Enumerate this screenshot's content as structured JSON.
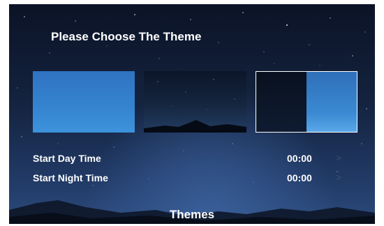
{
  "title": "Please Choose The Theme",
  "themes": [
    {
      "name": "blue-theme",
      "selected": false
    },
    {
      "name": "night-sky-theme",
      "selected": false
    },
    {
      "name": "split-auto-theme",
      "selected": true
    }
  ],
  "settings": [
    {
      "label": "Start Day Time",
      "value": "00:00",
      "icon": "chevron-right-icon"
    },
    {
      "label": "Start Night Time",
      "value": "00:00",
      "icon": "chevron-right-icon"
    }
  ],
  "chevron_glyph": ">",
  "footer_title": "Themes",
  "colors": {
    "accent_blue": "#3584d0",
    "night": "#14233f",
    "selected_border": "#ffffff"
  }
}
